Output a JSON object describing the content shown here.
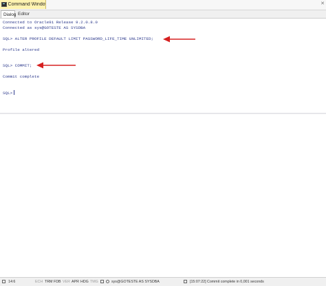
{
  "window": {
    "title": "Command Window"
  },
  "tabs": [
    {
      "label": "Dialog"
    },
    {
      "label": "Editor"
    }
  ],
  "output": {
    "lines": [
      "Connected to Oracle9i Release 9.2.0.8.0",
      "Connected as sys@GOTESTE AS SYSDBA",
      "SQL> ALTER PROFILE DEFAULT LIMIT PASSWORD_LIFE_TIME UNLIMITED;",
      "Profile altered",
      "SQL> COMMIT;",
      "Commit complete"
    ],
    "prompt": "SQL>"
  },
  "colors": {
    "annotation_arrow": "#d62020",
    "console_text": "#2d3a8c"
  },
  "status": {
    "position": "14:6",
    "flags": [
      "ECH",
      "TRM",
      "FDB",
      "VER",
      "APR",
      "HDG",
      "TMG"
    ],
    "connection": "sys@GOTESTE AS SYSDBA",
    "time": "[15:07:22]",
    "message": "Commit complete in 0,001 seconds"
  }
}
